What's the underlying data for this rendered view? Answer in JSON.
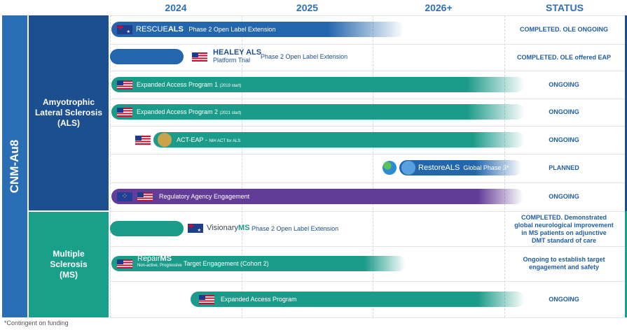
{
  "header": {
    "years": [
      "2024",
      "2025",
      "2026+"
    ],
    "status": "STATUS"
  },
  "program": "CNM-Au8",
  "diseases": {
    "als": [
      "Amyotrophic",
      "Lateral Sclerosis",
      "(ALS)"
    ],
    "ms": [
      "Multiple",
      "Sclerosis",
      "(MS)"
    ]
  },
  "rows": [
    {
      "brand_a": "RESCUE",
      "brand_b": "ALS",
      "label": "Phase 2  Open Label Extension",
      "status": [
        "COMPLETED. OLE ONGOING"
      ]
    },
    {
      "brand_a": "HEALEY ALS",
      "brand_b": "Platform Trial",
      "label": "Phase 2  Open Label Extension",
      "status": [
        "COMPLETED. OLE offered EAP"
      ]
    },
    {
      "label": "Expanded Access Program 1",
      "label_small": "(2019 start)",
      "status": [
        "ONGOING"
      ]
    },
    {
      "label": "Expanded Access Program 2",
      "label_small": "(2021 start)",
      "status": [
        "ONGOING"
      ]
    },
    {
      "label": "ACT-EAP -",
      "label_small": "NIH ACT for ALS",
      "status": [
        "ONGOING"
      ]
    },
    {
      "brand_a": "Restore",
      "brand_b": "ALS",
      "label": "Global Phase 3*",
      "status": [
        "PLANNED"
      ]
    },
    {
      "label": "Regulatory Agency Engagement",
      "status": [
        "ONGOING"
      ]
    },
    {
      "brand_a": "Visionary",
      "brand_b": "MS",
      "label": "Phase 2  Open Label Extension",
      "status": [
        "COMPLETED. Demonstrated",
        "global neurological improvement",
        "in MS patients on adjunctive",
        "DMT standard of care"
      ]
    },
    {
      "brand_a": "Repair",
      "brand_b": "MS",
      "brand_sub": "Non-active, Progressive",
      "label": "Target Engagement (Cohort 2)",
      "status": [
        "Ongoing to establish target",
        "engagement and safety"
      ]
    },
    {
      "label": "Expanded Access Program",
      "status": [
        "ONGOING"
      ]
    }
  ],
  "footnote": "*Contingent on funding",
  "colors": {
    "blue": "#2366ad",
    "navy": "#1c4f8f",
    "teal": "#1b9b89",
    "purple": "#623c97",
    "status_text": "#1f5ea4"
  },
  "icons": [
    "australia-flag-icon",
    "us-flag-icon",
    "eu-flag-icon",
    "globe-icon",
    "brain-icon"
  ]
}
